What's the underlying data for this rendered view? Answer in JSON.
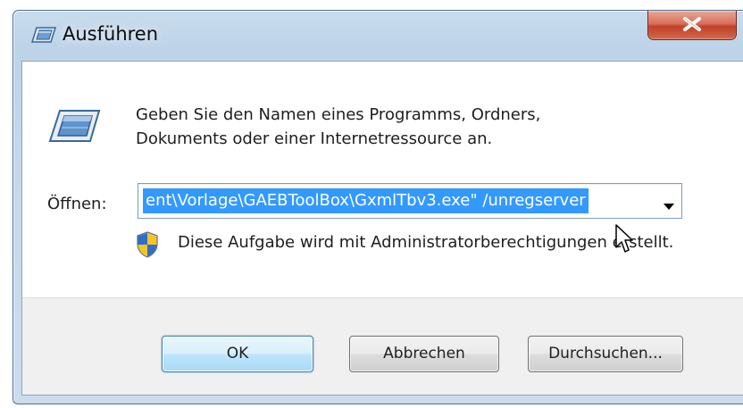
{
  "window": {
    "title": "Ausführen",
    "close_label": "x"
  },
  "dialog": {
    "description_line1": "Geben Sie den Namen eines Programms, Ordners,",
    "description_line2": "Dokuments oder einer Internetressource an.",
    "open_label": "Öffnen:",
    "open_value": "ent\\Vorlage\\GAEBToolBox\\GxmlTbv3.exe\" /unregserver",
    "admin_note": "Diese Aufgabe wird mit Administratorberechtigungen erstellt."
  },
  "buttons": {
    "ok": "OK",
    "cancel": "Abbrechen",
    "browse": "Durchsuchen..."
  },
  "icons": {
    "title": "run-icon",
    "main": "run-icon",
    "dropdown": "chevron-down-icon",
    "admin": "uac-shield-icon",
    "cursor": "mouse-pointer-icon"
  },
  "colors": {
    "selection": "#3399ff",
    "close_button": "#c2402a",
    "default_button_border": "#3c7fb1"
  }
}
